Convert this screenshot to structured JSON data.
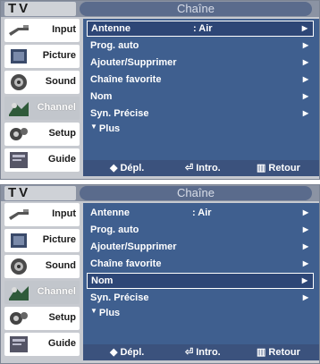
{
  "panels": [
    {
      "tv_label": "TV",
      "title": "Chaîne",
      "sidebar": [
        {
          "label": "Input",
          "icon": "input-icon"
        },
        {
          "label": "Picture",
          "icon": "picture-icon"
        },
        {
          "label": "Sound",
          "icon": "sound-icon"
        },
        {
          "label": "Channel",
          "icon": "channel-icon",
          "active": true
        },
        {
          "label": "Setup",
          "icon": "setup-icon"
        },
        {
          "label": "Guide",
          "icon": "guide-icon"
        }
      ],
      "menu": [
        {
          "label": "Antenne",
          "value": ": Air",
          "selected": true
        },
        {
          "label": "Prog. auto"
        },
        {
          "label": "Ajouter/Supprimer"
        },
        {
          "label": "Chaîne favorite"
        },
        {
          "label": "Nom"
        },
        {
          "label": "Syn. Précise"
        }
      ],
      "more": "Plus",
      "footer": {
        "move": "Dépl.",
        "enter": "Intro.",
        "back": "Retour"
      }
    },
    {
      "tv_label": "TV",
      "title": "Chaîne",
      "sidebar": [
        {
          "label": "Input",
          "icon": "input-icon"
        },
        {
          "label": "Picture",
          "icon": "picture-icon"
        },
        {
          "label": "Sound",
          "icon": "sound-icon"
        },
        {
          "label": "Channel",
          "icon": "channel-icon",
          "active": true
        },
        {
          "label": "Setup",
          "icon": "setup-icon"
        },
        {
          "label": "Guide",
          "icon": "guide-icon"
        }
      ],
      "menu": [
        {
          "label": "Antenne",
          "value": ": Air"
        },
        {
          "label": "Prog. auto"
        },
        {
          "label": "Ajouter/Supprimer"
        },
        {
          "label": "Chaîne favorite"
        },
        {
          "label": "Nom",
          "selected": true
        },
        {
          "label": "Syn. Précise"
        }
      ],
      "more": "Plus",
      "footer": {
        "move": "Dépl.",
        "enter": "Intro.",
        "back": "Retour"
      }
    }
  ],
  "colors": {
    "content_bg": "#3f5f8f",
    "footer_bg": "#3b527d",
    "title_bar": "#8b93a3",
    "panel_bg": "#c7cad0"
  }
}
